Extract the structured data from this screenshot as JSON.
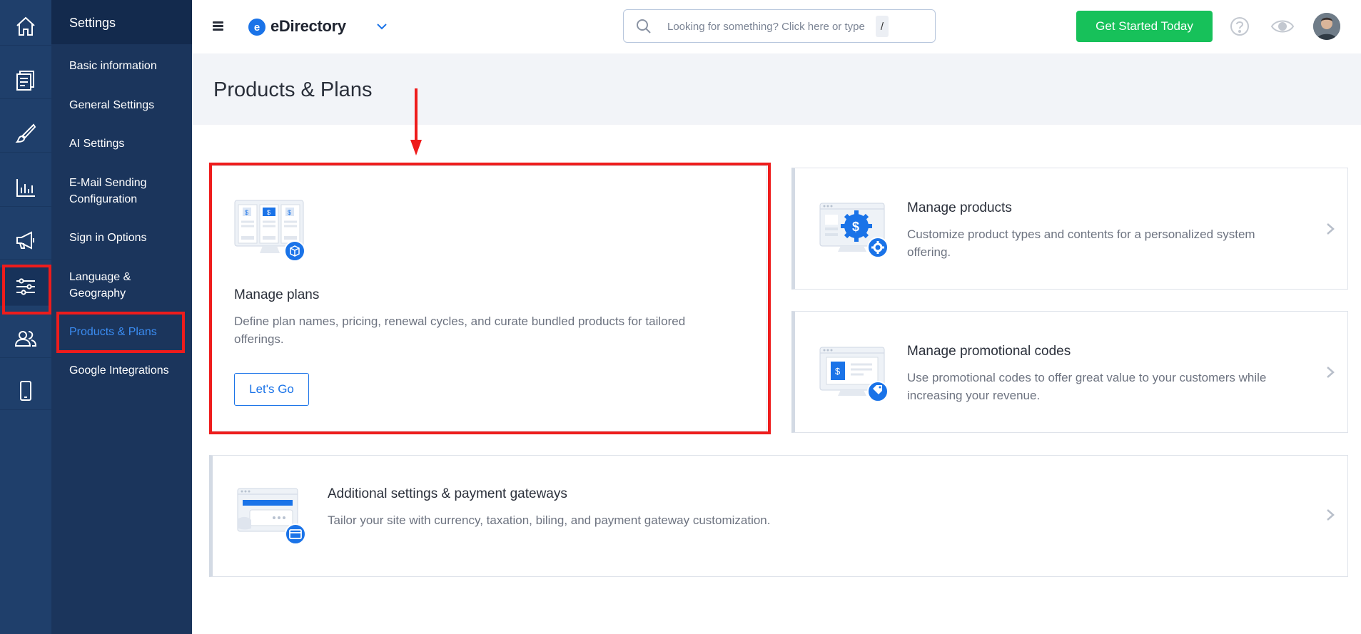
{
  "rail": {
    "items": [
      {
        "icon": "home-icon"
      },
      {
        "icon": "documents-icon"
      },
      {
        "icon": "brush-icon"
      },
      {
        "icon": "bar-chart-icon"
      },
      {
        "icon": "megaphone-icon"
      },
      {
        "icon": "sliders-icon",
        "active": true
      },
      {
        "icon": "users-icon"
      },
      {
        "icon": "mobile-icon"
      }
    ]
  },
  "sidebar": {
    "title": "Settings",
    "items": [
      {
        "label": "Basic information"
      },
      {
        "label": "General Settings"
      },
      {
        "label": "AI Settings"
      },
      {
        "label": "E-Mail Sending Configuration"
      },
      {
        "label": "Sign in Options"
      },
      {
        "label": "Language & Geography"
      },
      {
        "label": "Products & Plans",
        "active": true
      },
      {
        "label": "Google Integrations"
      }
    ]
  },
  "header": {
    "logo_letter": "e",
    "logo_text": "eDirectory",
    "search_placeholder": "Looking for something? Click here or type",
    "search_shortcut": "/",
    "cta_label": "Get Started Today"
  },
  "page": {
    "title": "Products & Plans"
  },
  "cards": {
    "plans": {
      "title": "Manage plans",
      "description": "Define plan names, pricing, renewal cycles, and curate bundled products for tailored offerings.",
      "button": "Let's Go"
    },
    "products": {
      "title": "Manage products",
      "description": "Customize product types and contents for a personalized system offering."
    },
    "promo": {
      "title": "Manage promotional codes",
      "description": "Use promotional codes to offer great value to your customers while increasing your revenue."
    },
    "additional": {
      "title": "Additional settings & payment gateways",
      "description": "Tailor your site with currency, taxation, biling, and payment gateway customization."
    }
  },
  "colors": {
    "rail_bg": "#1f3f6b",
    "sidebar_bg": "#1b355c",
    "accent": "#1a73e8",
    "cta": "#17c15a",
    "highlight": "#ee1c1c"
  }
}
